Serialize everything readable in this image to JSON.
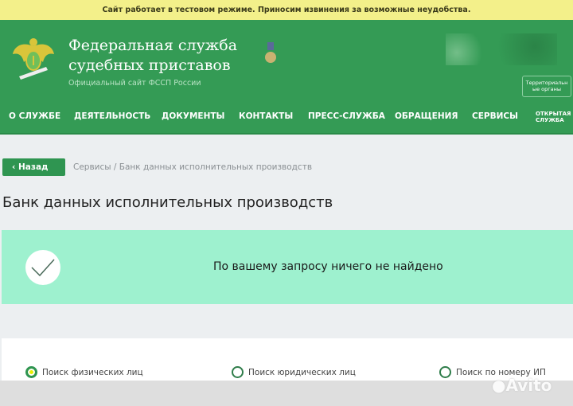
{
  "notice": "Сайт работает в тестовом режиме. Приносим извинения за возможные неудобства.",
  "header": {
    "title_line1": "Федеральная служба",
    "title_line2": "судебных приставов",
    "subtitle": "Официальный сайт ФССП России",
    "territory_button": "Территориальные органы"
  },
  "nav": [
    "О СЛУЖБЕ",
    "ДЕЯТЕЛЬНОСТЬ",
    "ДОКУМЕНТЫ",
    "КОНТАКТЫ",
    "ПРЕСС-СЛУЖБА",
    "ОБРАЩЕНИЯ",
    "СЕРВИСЫ",
    "ОТКРЫТАЯ СЛУЖБА"
  ],
  "back_label": "Назад",
  "breadcrumb": {
    "parent": "Сервисы",
    "separator": "/",
    "current": "Банк данных исполнительных производств"
  },
  "page_title": "Банк данных исполнительных производств",
  "alert": {
    "text": "По вашему запросу ничего не найдено"
  },
  "search_types": [
    {
      "label": "Поиск физических лиц",
      "selected": true
    },
    {
      "label": "Поиск юридических лиц",
      "selected": false
    },
    {
      "label": "Поиск по номеру ИП",
      "selected": false
    }
  ],
  "watermark": "Avito",
  "colors": {
    "brand_green": "#349b55",
    "notice_yellow": "#f3f08a",
    "alert_mint": "#9ef1cf"
  }
}
